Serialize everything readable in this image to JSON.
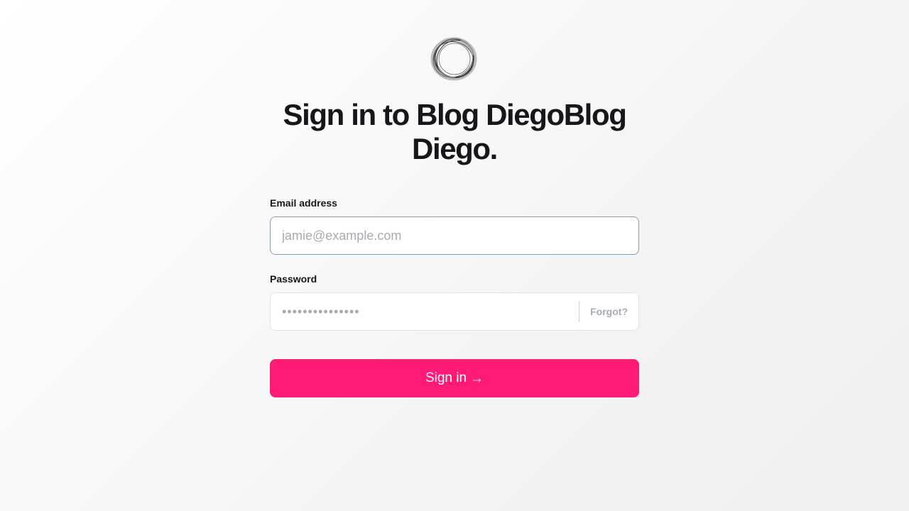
{
  "brand": {
    "logo_icon": "ring-logo-icon",
    "accent_color": "#ff1a75"
  },
  "title": "Sign in to Blog DiegoBlog Diego.",
  "form": {
    "email": {
      "label": "Email address",
      "placeholder": "jamie@example.com",
      "value": ""
    },
    "password": {
      "label": "Password",
      "placeholder": "•••••••••••••••",
      "value": "",
      "forgot_label": "Forgot?"
    },
    "submit": {
      "label": "Sign in",
      "icon": "arrow-right-icon",
      "arrow_glyph": "→"
    }
  }
}
